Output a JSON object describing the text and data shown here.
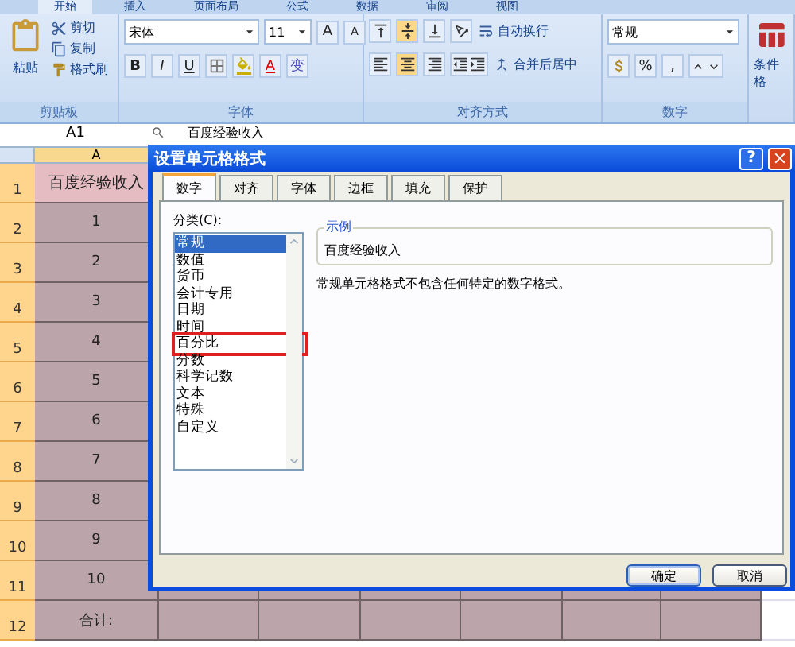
{
  "ribbon": {
    "tabs": [
      {
        "label": "开始",
        "selected": true
      },
      {
        "label": "插入",
        "selected": false
      },
      {
        "label": "页面布局",
        "selected": false
      },
      {
        "label": "公式",
        "selected": false
      },
      {
        "label": "数据",
        "selected": false
      },
      {
        "label": "审阅",
        "selected": false
      },
      {
        "label": "视图",
        "selected": false
      }
    ],
    "clipboard": {
      "paste": "粘贴",
      "cut": "剪切",
      "copy": "复制",
      "painter": "格式刷",
      "label": "剪贴板"
    },
    "font": {
      "name": "宋体",
      "size": "11",
      "grow": "A",
      "shrink": "A",
      "bold": "B",
      "italic": "I",
      "underline": "U",
      "font_color_letter": "A",
      "phonetic": "变",
      "label": "字体"
    },
    "alignment": {
      "wrap": "自动换行",
      "merge": "合并后居中",
      "label": "对齐方式"
    },
    "number": {
      "format": "常规",
      "percent": "%",
      "comma": ",",
      "label": "数字"
    },
    "styles": {
      "conditional": "条件格"
    }
  },
  "formula_bar": {
    "name_box": "A1",
    "content": "百度经验收入"
  },
  "sheet": {
    "column_header": "A",
    "rows": [
      {
        "number": "1",
        "value": "百度经验收入",
        "kind": "header"
      },
      {
        "number": "2",
        "value": "1",
        "kind": "data"
      },
      {
        "number": "3",
        "value": "2",
        "kind": "data"
      },
      {
        "number": "4",
        "value": "3",
        "kind": "data"
      },
      {
        "number": "5",
        "value": "4",
        "kind": "data"
      },
      {
        "number": "6",
        "value": "5",
        "kind": "data"
      },
      {
        "number": "7",
        "value": "6",
        "kind": "data"
      },
      {
        "number": "8",
        "value": "7",
        "kind": "data"
      },
      {
        "number": "9",
        "value": "8",
        "kind": "data"
      },
      {
        "number": "10",
        "value": "9",
        "kind": "data"
      },
      {
        "number": "11",
        "value": "10",
        "kind": "data"
      },
      {
        "number": "12",
        "value": "合计:",
        "kind": "total"
      }
    ]
  },
  "dialog": {
    "title": "设置单元格格式",
    "help": "?",
    "tabs": [
      {
        "label": "数字",
        "selected": true
      },
      {
        "label": "对齐",
        "selected": false
      },
      {
        "label": "字体",
        "selected": false
      },
      {
        "label": "边框",
        "selected": false
      },
      {
        "label": "填充",
        "selected": false
      },
      {
        "label": "保护",
        "selected": false
      }
    ],
    "category_label": "分类(C):",
    "categories": [
      {
        "label": "常规",
        "selected": true,
        "marked": false
      },
      {
        "label": "数值",
        "selected": false,
        "marked": false
      },
      {
        "label": "货币",
        "selected": false,
        "marked": false
      },
      {
        "label": "会计专用",
        "selected": false,
        "marked": false
      },
      {
        "label": "日期",
        "selected": false,
        "marked": false
      },
      {
        "label": "时间",
        "selected": false,
        "marked": false
      },
      {
        "label": "百分比",
        "selected": false,
        "marked": true
      },
      {
        "label": "分数",
        "selected": false,
        "marked": false
      },
      {
        "label": "科学记数",
        "selected": false,
        "marked": false
      },
      {
        "label": "文本",
        "selected": false,
        "marked": false
      },
      {
        "label": "特殊",
        "selected": false,
        "marked": false
      },
      {
        "label": "自定义",
        "selected": false,
        "marked": false
      }
    ],
    "sample_label": "示例",
    "sample_value": "百度经验收入",
    "description": "常规单元格格式不包含任何特定的数字格式。",
    "buttons": [
      {
        "label": "确定",
        "kind": "default"
      },
      {
        "label": "取消",
        "kind": "normal"
      }
    ]
  }
}
